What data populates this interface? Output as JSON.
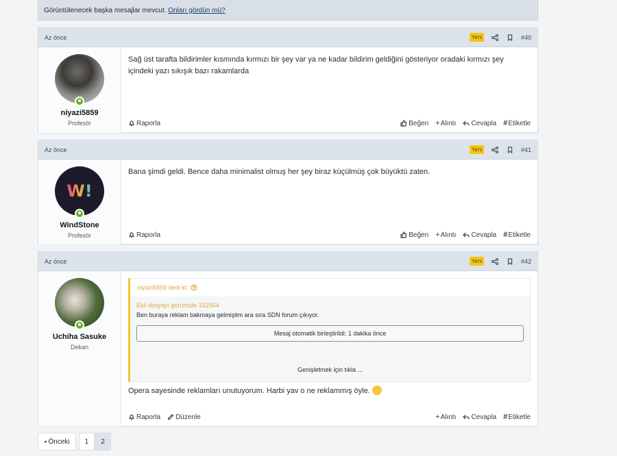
{
  "notice": {
    "text": "Görüntülenecek başka mesajlar mevcut.",
    "link": "Onları gördün mü?"
  },
  "posts": [
    {
      "time": "Az önce",
      "badge": "Yeni",
      "number": "#40",
      "user": {
        "name": "niyazi5859",
        "title": "Profesör"
      },
      "message": "Sağ üst tarafta bildirimler kısmında kırmızı bir şey var ya ne kadar bildirim geldiğini gösteriyor oradaki kırmızı şey içindeki yazı sıkışık bazı rakamlarda",
      "actions": {
        "report": "Raporla",
        "like": "Beğen",
        "quote": "Alıntı",
        "reply": "Cevapla",
        "tag": "Etiketle"
      }
    },
    {
      "time": "Az önce",
      "badge": "Yeni",
      "number": "#41",
      "user": {
        "name": "WindStone",
        "title": "Profesör"
      },
      "message": "Bana şimdi geldi. Bence daha minimalist olmuş her şey biraz küçülmüş çok büyüktü zaten.",
      "actions": {
        "report": "Raporla",
        "like": "Beğen",
        "quote": "Alıntı",
        "reply": "Cevapla",
        "tag": "Etiketle"
      }
    },
    {
      "time": "Az önce",
      "badge": "Yeni",
      "number": "#42",
      "user": {
        "name": "Uchiha Sasuke",
        "title": "Dekan"
      },
      "quote": {
        "author": "niyazi5859 dedi ki:",
        "attachment": "Ekli dosyayı görüntüle 152554",
        "text": "Ben buraya reklam bakmaya gelmiştim ara sıra SDN forum çıkıyor.",
        "merged": "Mesaj otomatik birleştirildi: 1 dakika önce",
        "expand": "Genişletmek için tıkla ..."
      },
      "message": "Opera sayesinde reklamları unutuyorum. Harbi yav o ne reklammış öyle.",
      "actions": {
        "report": "Raporla",
        "edit": "Düzenle",
        "quote": "Alıntı",
        "reply": "Cevapla",
        "tag": "Etiketle"
      }
    }
  ],
  "pagination": {
    "prev": "Önceki",
    "pages": [
      "1",
      "2"
    ],
    "current": "2"
  },
  "colors": {
    "badge": "#f5c518",
    "online": "#63b324",
    "quote_accent": "#f3c533",
    "header_bg": "#dde3ea"
  }
}
